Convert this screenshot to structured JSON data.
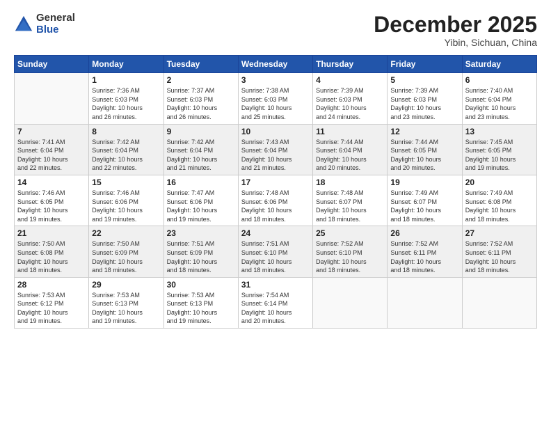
{
  "header": {
    "logo_general": "General",
    "logo_blue": "Blue",
    "month_title": "December 2025",
    "subtitle": "Yibin, Sichuan, China"
  },
  "weekdays": [
    "Sunday",
    "Monday",
    "Tuesday",
    "Wednesday",
    "Thursday",
    "Friday",
    "Saturday"
  ],
  "rows": [
    [
      {
        "day": "",
        "info": ""
      },
      {
        "day": "1",
        "info": "Sunrise: 7:36 AM\nSunset: 6:03 PM\nDaylight: 10 hours\nand 26 minutes."
      },
      {
        "day": "2",
        "info": "Sunrise: 7:37 AM\nSunset: 6:03 PM\nDaylight: 10 hours\nand 26 minutes."
      },
      {
        "day": "3",
        "info": "Sunrise: 7:38 AM\nSunset: 6:03 PM\nDaylight: 10 hours\nand 25 minutes."
      },
      {
        "day": "4",
        "info": "Sunrise: 7:39 AM\nSunset: 6:03 PM\nDaylight: 10 hours\nand 24 minutes."
      },
      {
        "day": "5",
        "info": "Sunrise: 7:39 AM\nSunset: 6:03 PM\nDaylight: 10 hours\nand 23 minutes."
      },
      {
        "day": "6",
        "info": "Sunrise: 7:40 AM\nSunset: 6:04 PM\nDaylight: 10 hours\nand 23 minutes."
      }
    ],
    [
      {
        "day": "7",
        "info": "Sunrise: 7:41 AM\nSunset: 6:04 PM\nDaylight: 10 hours\nand 22 minutes."
      },
      {
        "day": "8",
        "info": "Sunrise: 7:42 AM\nSunset: 6:04 PM\nDaylight: 10 hours\nand 22 minutes."
      },
      {
        "day": "9",
        "info": "Sunrise: 7:42 AM\nSunset: 6:04 PM\nDaylight: 10 hours\nand 21 minutes."
      },
      {
        "day": "10",
        "info": "Sunrise: 7:43 AM\nSunset: 6:04 PM\nDaylight: 10 hours\nand 21 minutes."
      },
      {
        "day": "11",
        "info": "Sunrise: 7:44 AM\nSunset: 6:04 PM\nDaylight: 10 hours\nand 20 minutes."
      },
      {
        "day": "12",
        "info": "Sunrise: 7:44 AM\nSunset: 6:05 PM\nDaylight: 10 hours\nand 20 minutes."
      },
      {
        "day": "13",
        "info": "Sunrise: 7:45 AM\nSunset: 6:05 PM\nDaylight: 10 hours\nand 19 minutes."
      }
    ],
    [
      {
        "day": "14",
        "info": "Sunrise: 7:46 AM\nSunset: 6:05 PM\nDaylight: 10 hours\nand 19 minutes."
      },
      {
        "day": "15",
        "info": "Sunrise: 7:46 AM\nSunset: 6:06 PM\nDaylight: 10 hours\nand 19 minutes."
      },
      {
        "day": "16",
        "info": "Sunrise: 7:47 AM\nSunset: 6:06 PM\nDaylight: 10 hours\nand 19 minutes."
      },
      {
        "day": "17",
        "info": "Sunrise: 7:48 AM\nSunset: 6:06 PM\nDaylight: 10 hours\nand 18 minutes."
      },
      {
        "day": "18",
        "info": "Sunrise: 7:48 AM\nSunset: 6:07 PM\nDaylight: 10 hours\nand 18 minutes."
      },
      {
        "day": "19",
        "info": "Sunrise: 7:49 AM\nSunset: 6:07 PM\nDaylight: 10 hours\nand 18 minutes."
      },
      {
        "day": "20",
        "info": "Sunrise: 7:49 AM\nSunset: 6:08 PM\nDaylight: 10 hours\nand 18 minutes."
      }
    ],
    [
      {
        "day": "21",
        "info": "Sunrise: 7:50 AM\nSunset: 6:08 PM\nDaylight: 10 hours\nand 18 minutes."
      },
      {
        "day": "22",
        "info": "Sunrise: 7:50 AM\nSunset: 6:09 PM\nDaylight: 10 hours\nand 18 minutes."
      },
      {
        "day": "23",
        "info": "Sunrise: 7:51 AM\nSunset: 6:09 PM\nDaylight: 10 hours\nand 18 minutes."
      },
      {
        "day": "24",
        "info": "Sunrise: 7:51 AM\nSunset: 6:10 PM\nDaylight: 10 hours\nand 18 minutes."
      },
      {
        "day": "25",
        "info": "Sunrise: 7:52 AM\nSunset: 6:10 PM\nDaylight: 10 hours\nand 18 minutes."
      },
      {
        "day": "26",
        "info": "Sunrise: 7:52 AM\nSunset: 6:11 PM\nDaylight: 10 hours\nand 18 minutes."
      },
      {
        "day": "27",
        "info": "Sunrise: 7:52 AM\nSunset: 6:11 PM\nDaylight: 10 hours\nand 18 minutes."
      }
    ],
    [
      {
        "day": "28",
        "info": "Sunrise: 7:53 AM\nSunset: 6:12 PM\nDaylight: 10 hours\nand 19 minutes."
      },
      {
        "day": "29",
        "info": "Sunrise: 7:53 AM\nSunset: 6:13 PM\nDaylight: 10 hours\nand 19 minutes."
      },
      {
        "day": "30",
        "info": "Sunrise: 7:53 AM\nSunset: 6:13 PM\nDaylight: 10 hours\nand 19 minutes."
      },
      {
        "day": "31",
        "info": "Sunrise: 7:54 AM\nSunset: 6:14 PM\nDaylight: 10 hours\nand 20 minutes."
      },
      {
        "day": "",
        "info": ""
      },
      {
        "day": "",
        "info": ""
      },
      {
        "day": "",
        "info": ""
      }
    ]
  ]
}
